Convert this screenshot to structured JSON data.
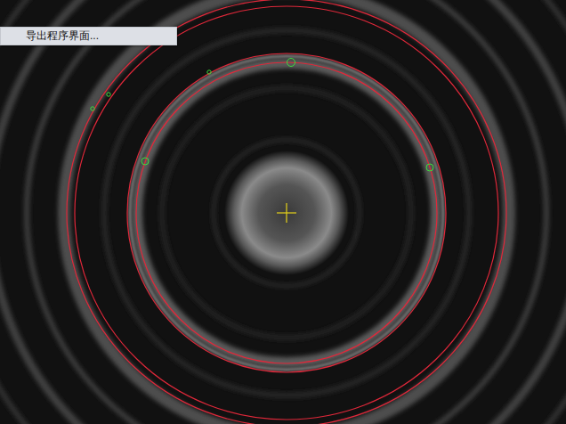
{
  "context_menu": {
    "items": [
      {
        "label": "导出程序界面..."
      }
    ]
  }
}
